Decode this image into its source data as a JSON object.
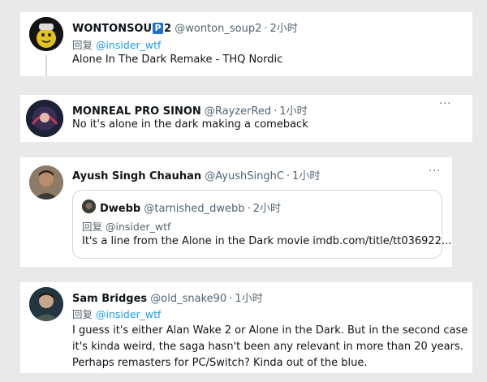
{
  "tweets": [
    {
      "name": "WONTONSOU",
      "badge": "P",
      "name_suffix": "2",
      "handle": "@wonton_soup2",
      "dot": "·",
      "time": "2小时",
      "reply_prefix": "回复",
      "reply_mention": "@insider_wtf",
      "text": "Alone In The Dark Remake - THQ Nordic"
    },
    {
      "name": "MONREAL PRO SINON",
      "handle": "@RayzerRed",
      "dot": "·",
      "time": "1小时",
      "more": "···",
      "text": "No it's alone in the dark making a comeback"
    },
    {
      "name": "Ayush Singh Chauhan",
      "handle": "@AyushSinghC",
      "dot": "·",
      "time": "1小时",
      "more": "···",
      "quote": {
        "name": "Dwebb",
        "handle": "@tarnished_dwebb",
        "dot": "·",
        "time": "2小时",
        "reply_prefix": "回复",
        "reply_mention": "@insider_wtf",
        "text": "It's a line from the Alone in the Dark movie imdb.com/title/tt036922..."
      }
    },
    {
      "name": "Sam Bridges",
      "handle": "@old_snake90",
      "dot": "·",
      "time": "1小时",
      "reply_prefix": "回复",
      "reply_mention": "@insider_wtf",
      "text_lines": [
        "I guess it's either Alan Wake 2 or Alone in the Dark. But in the second case",
        "it's kinda weird, the saga hasn't been any relevant in more than 20 years.",
        "Perhaps remasters for PC/Switch? Kinda out of the blue."
      ]
    }
  ],
  "colors": {
    "accent": "#1d9bf0",
    "secondary": "#536471",
    "border": "#cfd9de"
  }
}
